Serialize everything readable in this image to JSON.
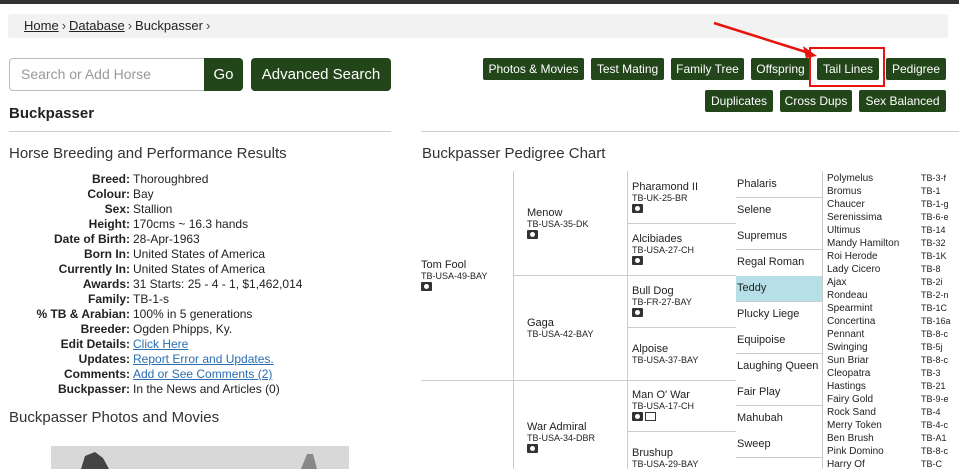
{
  "breadcrumb": {
    "home": "Home",
    "database": "Database",
    "current": "Buckpasser"
  },
  "search": {
    "placeholder": "Search or Add Horse",
    "go": "Go",
    "advanced": "Advanced Search"
  },
  "nav": {
    "photos": "Photos & Movies",
    "test_mating": "Test Mating",
    "family_tree": "Family Tree",
    "offspring": "Offspring",
    "tail_lines": "Tail Lines",
    "pedigree": "Pedigree",
    "duplicates": "Duplicates",
    "cross_dups": "Cross Dups",
    "sex_balanced": "Sex Balanced"
  },
  "horse_name": "Buckpasser",
  "results_title": "Horse Breeding and Performance Results",
  "photos_title": "Buckpasser Photos and Movies",
  "pedigree_title": "Buckpasser Pedigree Chart",
  "info": [
    {
      "label": "Breed:",
      "value": "Thoroughbred"
    },
    {
      "label": "Colour:",
      "value": "Bay"
    },
    {
      "label": "Sex:",
      "value": "Stallion"
    },
    {
      "label": "Height:",
      "value": "170cms ~ 16.3 hands"
    },
    {
      "label": "Date of Birth:",
      "value": "28-Apr-1963"
    },
    {
      "label": "Born In:",
      "value": "United States of America"
    },
    {
      "label": "Currently In:",
      "value": "United States of America"
    },
    {
      "label": "Awards:",
      "value": "31 Starts: 25 - 4 - 1, $1,462,014"
    },
    {
      "label": "Family:",
      "value": "TB-1-s"
    },
    {
      "label": "% TB & Arabian:",
      "value": "100% in 5 generations"
    },
    {
      "label": "Breeder:",
      "value": "Ogden Phipps, Ky."
    },
    {
      "label": "Edit Details:",
      "value": "Click Here"
    },
    {
      "label": "Updates:",
      "value": "Report Error and Updates."
    },
    {
      "label": "Comments:",
      "value": "Add or See Comments (2)"
    },
    {
      "label": "Buckpasser:",
      "value": "In the News and Articles (0)"
    }
  ],
  "pedigree": {
    "g1": [
      {
        "name": "Tom Fool",
        "reg": "TB-USA-49-BAY"
      }
    ],
    "g2": [
      {
        "name": "Menow",
        "reg": "TB-USA-35-DK"
      },
      {
        "name": "Gaga",
        "reg": "TB-USA-42-BAY"
      },
      {
        "name": "War Admiral",
        "reg": "TB-USA-34-DBR"
      }
    ],
    "g3": [
      {
        "name": "Pharamond II",
        "reg": "TB-UK-25-BR"
      },
      {
        "name": "Alcibiades",
        "reg": "TB-USA-27-CH"
      },
      {
        "name": "Bull Dog",
        "reg": "TB-FR-27-BAY"
      },
      {
        "name": "Alpoise",
        "reg": "TB-USA-37-BAY"
      },
      {
        "name": "Man O' War",
        "reg": "TB-USA-17-CH"
      },
      {
        "name": "Brushup",
        "reg": "TB-USA-29-BAY"
      }
    ],
    "g4": [
      "Phalaris",
      "Selene",
      "Supremus",
      "Regal Roman",
      "Teddy",
      "Plucky Liege",
      "Equipoise",
      "Laughing Queen",
      "Fair Play",
      "Mahubah",
      "Sweep"
    ],
    "g5": [
      {
        "name": "Polymelus",
        "code": "TB-3-f"
      },
      {
        "name": "Bromus",
        "code": "TB-1"
      },
      {
        "name": "Chaucer",
        "code": "TB-1-g"
      },
      {
        "name": "Serenissima",
        "code": "TB-6-e"
      },
      {
        "name": "Ultimus",
        "code": "TB-14"
      },
      {
        "name": "Mandy Hamilton",
        "code": "TB-32"
      },
      {
        "name": "Roi Herode",
        "code": "TB-1K"
      },
      {
        "name": "Lady Cicero",
        "code": "TB-8"
      },
      {
        "name": "Ajax",
        "code": "TB-2i"
      },
      {
        "name": "Rondeau",
        "code": "TB-2-n"
      },
      {
        "name": "Spearmint",
        "code": "TB-1C"
      },
      {
        "name": "Concertina",
        "code": "TB-16a"
      },
      {
        "name": "Pennant",
        "code": "TB-8-c"
      },
      {
        "name": "Swinging",
        "code": "TB-5j"
      },
      {
        "name": "Sun Briar",
        "code": "TB-8-c"
      },
      {
        "name": "Cleopatra",
        "code": "TB-3"
      },
      {
        "name": "Hastings",
        "code": "TB-21"
      },
      {
        "name": "Fairy Gold",
        "code": "TB-9-e"
      },
      {
        "name": "Rock Sand",
        "code": "TB-4"
      },
      {
        "name": "Merry Token",
        "code": "TB-4-c"
      },
      {
        "name": "Ben Brush",
        "code": "TB-A1"
      },
      {
        "name": "Pink Domino",
        "code": "TB-8-c"
      },
      {
        "name": "Harry Of",
        "code": "TB-C"
      }
    ]
  }
}
